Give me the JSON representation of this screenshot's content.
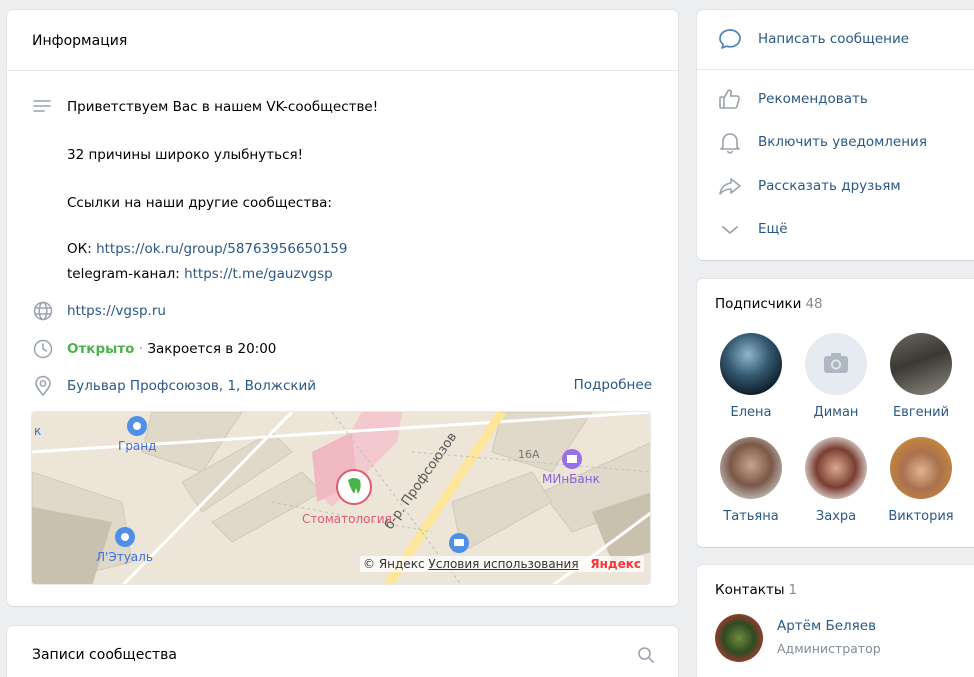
{
  "info": {
    "title": "Информация",
    "description": {
      "line1": "Приветствуем Вас в нашем VK-сообществе!",
      "line2": "32 причины широко улыбнуться!",
      "line3": "Ссылки на наши другие сообщества:",
      "ok_prefix": "ОК: ",
      "ok_link": "https://ok.ru/group/58763956650159",
      "tg_prefix": "telegram-канал: ",
      "tg_link": "https://t.me/gauzvgsp"
    },
    "website": "https://vgsp.ru",
    "hours": {
      "status": "Открыто",
      "separator": " · ",
      "closes": "Закроется в 20:00"
    },
    "address": "Бульвар Профсоюзов, 1, Волжский",
    "more_label": "Подробнее",
    "map": {
      "labels": {
        "grand": "Гранд",
        "stomatology": "Стоматология",
        "street": "б-р. Профсоюзов",
        "minbank": "МИнБанк",
        "house": "16А",
        "etual": "Л'Этуаль",
        "k": "к"
      },
      "copyright": "© Яндекс",
      "terms": "Условия использования",
      "brand": "Яндекс"
    }
  },
  "posts": {
    "title": "Записи сообщества"
  },
  "actions": {
    "items": [
      {
        "label": "Написать сообщение",
        "icon": "message-icon"
      },
      {
        "label": "Рекомендовать",
        "icon": "thumbs-up-icon"
      },
      {
        "label": "Включить уведомления",
        "icon": "bell-icon"
      },
      {
        "label": "Рассказать друзьям",
        "icon": "share-icon"
      },
      {
        "label": "Ещё",
        "icon": "chevron-down-icon"
      }
    ]
  },
  "subscribers": {
    "title": "Подписчики",
    "count": "48",
    "people": [
      {
        "name": "Елена"
      },
      {
        "name": "Диман"
      },
      {
        "name": "Евгений"
      },
      {
        "name": "Татьяна"
      },
      {
        "name": "Захра"
      },
      {
        "name": "Виктория"
      }
    ]
  },
  "contacts": {
    "title": "Контакты",
    "count": "1",
    "person": {
      "name": "Артём Беляев",
      "role": "Администратор"
    }
  },
  "colors": {
    "link": "#2a5885",
    "open": "#4bb34b",
    "bg": "#edeef0",
    "icon": "#99a2ad",
    "accent": "#5181b8"
  }
}
